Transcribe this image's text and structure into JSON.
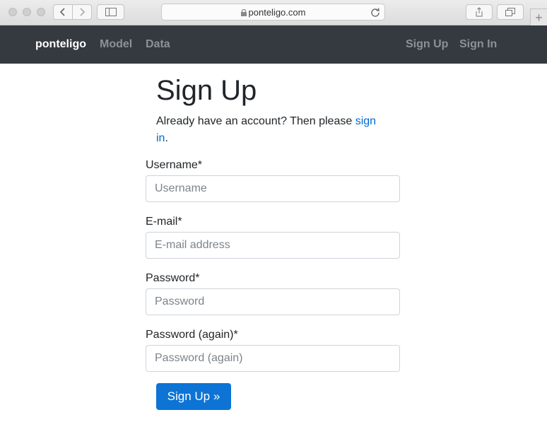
{
  "browser": {
    "url": "ponteligo.com",
    "new_tab_label": "+"
  },
  "navbar": {
    "brand": "ponteligo",
    "links": [
      "Model",
      "Data"
    ],
    "right_links": [
      "Sign Up",
      "Sign In"
    ]
  },
  "page": {
    "title": "Sign Up",
    "lead_text": "Already have an account? Then please ",
    "lead_link": "sign in",
    "lead_end": "."
  },
  "form": {
    "username": {
      "label": "Username*",
      "placeholder": "Username",
      "value": ""
    },
    "email": {
      "label": "E-mail*",
      "placeholder": "E-mail address",
      "value": ""
    },
    "password": {
      "label": "Password*",
      "placeholder": "Password",
      "value": ""
    },
    "password2": {
      "label": "Password (again)*",
      "placeholder": "Password (again)",
      "value": ""
    },
    "submit_label": "Sign Up »"
  },
  "colors": {
    "navbar_bg": "#343a40",
    "primary": "#0d74d6",
    "link": "#0069d2"
  }
}
